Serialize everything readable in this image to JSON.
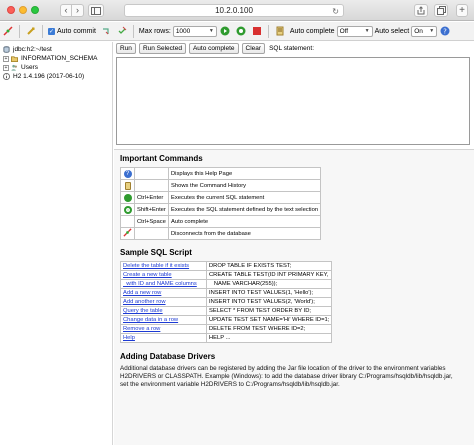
{
  "browser": {
    "address": "10.2.0.100",
    "back": "‹",
    "forward": "›",
    "plus": "+"
  },
  "toolbar": {
    "auto_commit_label": "Auto commit",
    "max_rows_label": "Max rows:",
    "max_rows_value": "1000",
    "auto_complete_label": "Auto complete",
    "auto_complete_value": "Off",
    "auto_select_label": "Auto select",
    "auto_select_value": "On"
  },
  "tree": {
    "connection": "jdbc:h2:~/test",
    "items": [
      {
        "label": "INFORMATION_SCHEMA"
      },
      {
        "label": "Users"
      }
    ],
    "version": "H2 1.4.196 (2017-06-10)"
  },
  "sql": {
    "run_label": "Run",
    "run_selected_label": "Run Selected",
    "auto_complete_label": "Auto complete",
    "clear_label": "Clear",
    "statement_label": "SQL statement:"
  },
  "commands": {
    "title": "Important Commands",
    "rows": [
      {
        "icon": "help-icon",
        "key": "",
        "desc": "Displays this Help Page"
      },
      {
        "icon": "history-icon",
        "key": "",
        "desc": "Shows the Command History"
      },
      {
        "icon": "run-icon",
        "key": "Ctrl+Enter",
        "desc": "Executes the current SQL statement"
      },
      {
        "icon": "run-selected-icon",
        "key": "Shift+Enter",
        "desc": "Executes the SQL statement defined by the text selection"
      },
      {
        "icon": "",
        "key": "Ctrl+Space",
        "desc": "Auto complete"
      },
      {
        "icon": "disconnect-icon",
        "key": "",
        "desc": "Disconnects from the database"
      }
    ]
  },
  "sample": {
    "title": "Sample SQL Script",
    "rows": [
      {
        "link": "Delete the table if it exists",
        "sql": "DROP TABLE IF EXISTS TEST;"
      },
      {
        "link": "Create a new table",
        "sql": "CREATE TABLE TEST(ID INT PRIMARY KEY,"
      },
      {
        "link": "  with ID and NAME columns",
        "sql": "   NAME VARCHAR(255));"
      },
      {
        "link": "Add a new row",
        "sql": "INSERT INTO TEST VALUES(1, 'Hello');"
      },
      {
        "link": "Add another row",
        "sql": "INSERT INTO TEST VALUES(2, 'World');"
      },
      {
        "link": "Query the table",
        "sql": "SELECT * FROM TEST ORDER BY ID;"
      },
      {
        "link": "Change data in a row",
        "sql": "UPDATE TEST SET NAME='Hi' WHERE ID=1;"
      },
      {
        "link": "Remove a row",
        "sql": "DELETE FROM TEST WHERE ID=2;"
      },
      {
        "link": "Help",
        "sql": "HELP ..."
      }
    ]
  },
  "drivers": {
    "title": "Adding Database Drivers",
    "text": "Additional database drivers can be registered by adding the Jar file location of the driver to the environment variables H2DRIVERS or CLASSPATH. Example (Windows): to add the database driver library C:/Programs/hsqldb/lib/hsqldb.jar, set the environment variable H2DRIVERS to C:/Programs/hsqldb/lib/hsqldb.jar."
  }
}
